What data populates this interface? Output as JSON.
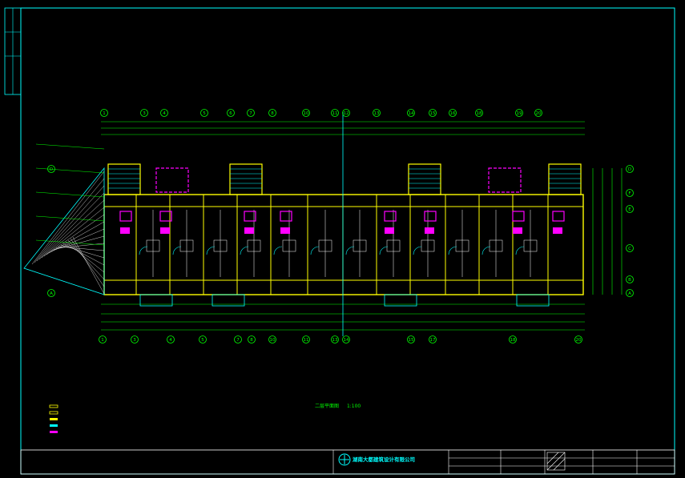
{
  "drawing": {
    "plan_title": "二层平面图",
    "plan_scale": "1:100",
    "company_name": "湖南大都建筑设计有限公司"
  },
  "axes": {
    "top": [
      "1",
      "3",
      "4",
      "5",
      "6",
      "7",
      "8",
      "10",
      "11",
      "12",
      "13",
      "14",
      "15",
      "16",
      "18",
      "19",
      "20"
    ],
    "bottom": [
      "1",
      "3",
      "4",
      "5",
      "7",
      "8",
      "10",
      "11",
      "13",
      "14",
      "15",
      "17",
      "18",
      "20"
    ],
    "left": [
      "D",
      "A"
    ],
    "right": [
      "D",
      "F",
      "E",
      "C",
      "B",
      "A"
    ]
  },
  "colors": {
    "background": "#000000",
    "frame": "#00ffff",
    "walls": "#ffff00",
    "dims": "#00ff00",
    "magenta": "#ff00ff",
    "white": "#ffffff"
  }
}
